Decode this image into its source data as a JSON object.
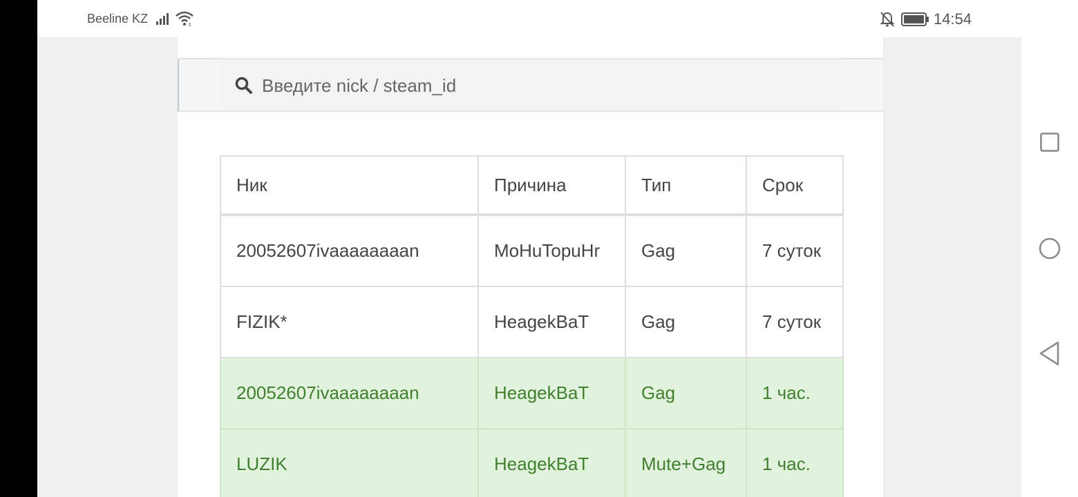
{
  "status_bar": {
    "carrier": "Beeline KZ",
    "time": "14:54",
    "icons": [
      "signal-icon",
      "wifi-icon",
      "mute-icon",
      "battery-icon"
    ]
  },
  "search": {
    "placeholder": "Введите nick / steam_id",
    "value": ""
  },
  "table": {
    "headers": [
      "Ник",
      "Причина",
      "Тип",
      "Срок"
    ],
    "rows": [
      {
        "nick": "20052607ivaaaaaaaan",
        "reason": "MoHuTopuHr",
        "type": "Gag",
        "term": "7 суток",
        "highlight": false
      },
      {
        "nick": "FIZIK*",
        "reason": "HeagekBaT",
        "type": "Gag",
        "term": "7 суток",
        "highlight": false
      },
      {
        "nick": "20052607ivaaaaaaaan",
        "reason": "HeagekBaT",
        "type": "Gag",
        "term": "1 час.",
        "highlight": true
      },
      {
        "nick": "LUZIK",
        "reason": "HeagekBaT",
        "type": "Mute+Gag",
        "term": "1 час.",
        "highlight": true
      }
    ]
  },
  "colors": {
    "highlight_row_bg": "#e1f3dc",
    "highlight_row_text": "#3f7f2f",
    "status_bar_bg": "#ffffff",
    "page_bg": "#efefef"
  },
  "nav_bar": {
    "icons": [
      "recent-apps-icon",
      "home-icon",
      "back-icon"
    ]
  }
}
